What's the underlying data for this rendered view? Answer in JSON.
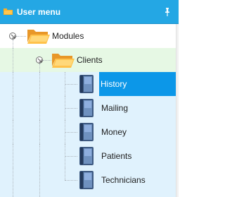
{
  "header": {
    "title": "User menu",
    "folder_icon": "folder-icon",
    "pin_icon": "pin-icon"
  },
  "tree": {
    "modules": {
      "label": "Modules",
      "icon": "folder-open-icon",
      "expanded": true
    },
    "clients": {
      "label": "Clients",
      "icon": "folder-open-icon",
      "expanded": true
    },
    "items": [
      {
        "label": "History",
        "selected": true,
        "icon": "book-icon"
      },
      {
        "label": "Mailing",
        "selected": false,
        "icon": "book-icon"
      },
      {
        "label": "Money",
        "selected": false,
        "icon": "book-icon"
      },
      {
        "label": "Patients",
        "selected": false,
        "icon": "book-icon"
      },
      {
        "label": "Technicians",
        "selected": false,
        "icon": "book-icon"
      }
    ]
  },
  "colors": {
    "header_bg": "#24a7e4",
    "selected_bg": "#0c97e8",
    "level1_bg": "#e6f8e4",
    "level2_bg": "#e0f2fd"
  }
}
